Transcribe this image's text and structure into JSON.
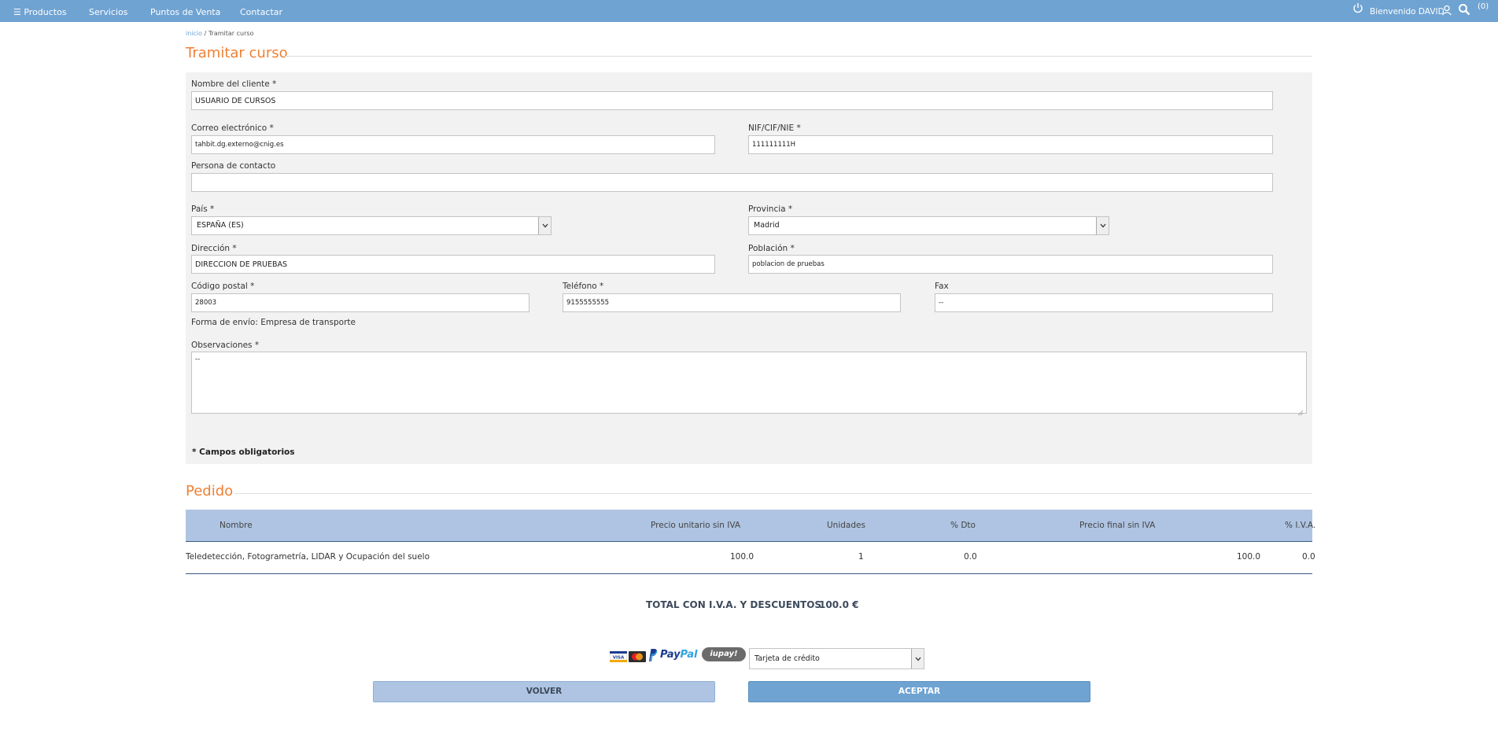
{
  "nav": {
    "items": [
      {
        "label": "☰ Productos"
      },
      {
        "label": "Servicios"
      },
      {
        "label": "Puntos de Venta"
      },
      {
        "label": "Contactar"
      }
    ],
    "welcome": "Bienvenido DAVID",
    "cart_count": "(0)",
    "icons": [
      "power-icon",
      "user-icon",
      "search-icon"
    ]
  },
  "breadcrumb": {
    "home": "inicio",
    "separator": " / ",
    "current": "Tramitar curso"
  },
  "form": {
    "title": "Tramitar curso",
    "fields": {
      "cliente": {
        "label": "Nombre del cliente *",
        "value": "USUARIO DE CURSOS"
      },
      "correo": {
        "label": "Correo electrónico *",
        "value": "tahbit.dg.externo@cnig.es"
      },
      "nif": {
        "label": "NIF/CIF/NIE *",
        "value": "111111111H"
      },
      "contacto": {
        "label": "Persona de contacto",
        "value": ""
      },
      "pais": {
        "label": "País *",
        "value": "ESPAÑA (ES)"
      },
      "provincia": {
        "label": "Provincia *",
        "value": "Madrid"
      },
      "direccion": {
        "label": "Dirección *",
        "value": "DIRECCION DE PRUEBAS"
      },
      "poblacion": {
        "label": "Población *",
        "value": "poblacion de pruebas"
      },
      "cp": {
        "label": "Código postal *",
        "value": "28003"
      },
      "telefono": {
        "label": "Teléfono *",
        "value": "9155555555"
      },
      "fax": {
        "label": "Fax",
        "value": "--"
      },
      "observaciones": {
        "label": "Observaciones *",
        "value": "--"
      }
    },
    "envio": "Forma de envío: Empresa de transporte",
    "required_note": "* Campos obligatorios"
  },
  "order": {
    "title": "Pedido",
    "columns": [
      "Nombre",
      "Precio unitario sin IVA",
      "Unidades",
      "% Dto",
      "Precio final sin IVA",
      "% I.V.A."
    ],
    "rows": [
      {
        "nombre": "Teledetección, Fotogrametría, LIDAR y Ocupación del suelo",
        "precio_unitario": "100.0",
        "unidades": "1",
        "dto": "0.0",
        "precio_final": "100.0",
        "iva": "0.0"
      }
    ],
    "total_label": "TOTAL CON I.V.A. Y DESCUENTOS",
    "total_value": "100.0 €"
  },
  "payment": {
    "logos": {
      "visa": "VISA",
      "paypal": "PayPal",
      "iupay": "iupay!"
    },
    "method": "Tarjeta de crédito"
  },
  "buttons": {
    "volver": "VOLVER",
    "aceptar": "ACEPTAR"
  },
  "colors": {
    "nav": "#6fa3d2",
    "accent": "#f07f33",
    "table_header": "#aec4e2"
  }
}
